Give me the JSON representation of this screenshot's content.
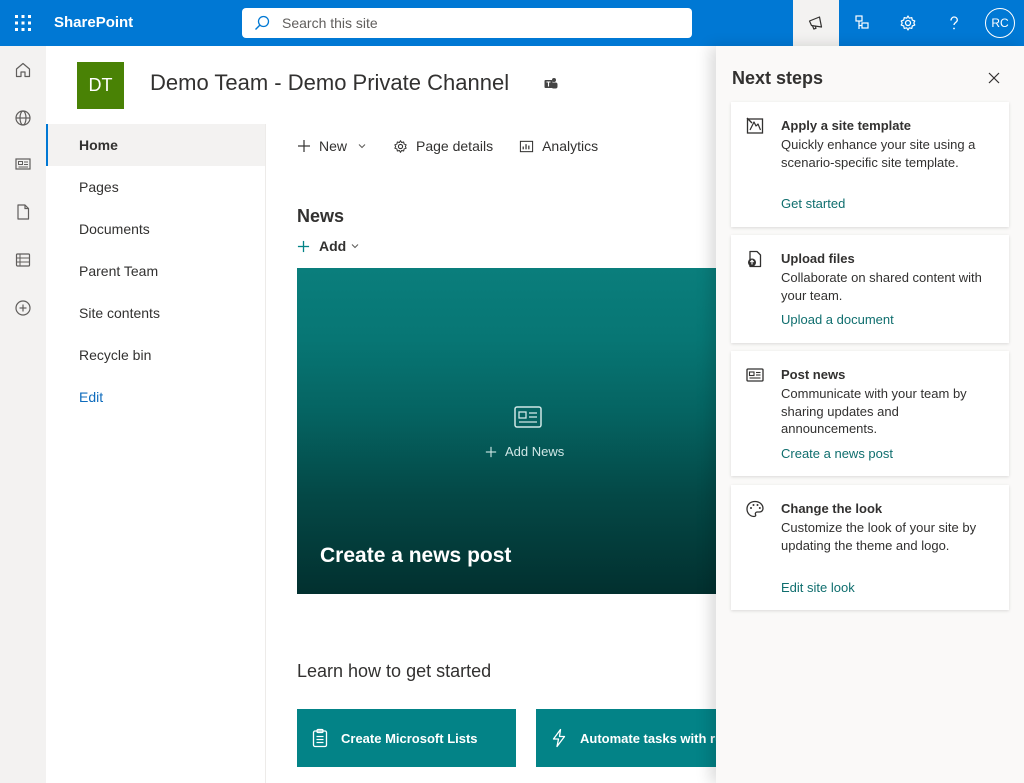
{
  "suite": {
    "app_name": "SharePoint",
    "search_placeholder": "Search this site",
    "user_initials": "RC"
  },
  "site": {
    "logo_initials": "DT",
    "title": "Demo Team - Demo Private Channel",
    "logo_color": "#498205"
  },
  "nav": {
    "items": [
      {
        "label": "Home",
        "selected": true
      },
      {
        "label": "Pages"
      },
      {
        "label": "Documents"
      },
      {
        "label": "Parent Team"
      },
      {
        "label": "Site contents"
      },
      {
        "label": "Recycle bin"
      }
    ],
    "edit_label": "Edit"
  },
  "commands": {
    "new_label": "New",
    "page_details_label": "Page details",
    "analytics_label": "Analytics"
  },
  "news": {
    "title": "News",
    "add_label": "Add",
    "card_add_label": "Add News",
    "card_title": "Create a news post"
  },
  "learn": {
    "title": "Learn how to get started",
    "buttons": [
      {
        "label": "Create Microsoft Lists"
      },
      {
        "label": "Automate tasks with rules"
      }
    ]
  },
  "next_steps": {
    "title": "Next steps",
    "steps": [
      {
        "title": "Apply a site template",
        "description": "Quickly enhance your site using a scenario-specific site template.",
        "link": "Get started"
      },
      {
        "title": "Upload files",
        "description": "Collaborate on shared content with your team.",
        "link": "Upload a document"
      },
      {
        "title": "Post news",
        "description": "Communicate with your team by sharing updates and announcements.",
        "link": "Create a news post"
      },
      {
        "title": "Change the look",
        "description": "Customize the look of your site by updating the theme and logo.",
        "link": "Edit site look"
      }
    ]
  },
  "colors": {
    "suite_bar": "#0078d4",
    "teal": "#038387",
    "link_teal": "#0f6e6e"
  }
}
